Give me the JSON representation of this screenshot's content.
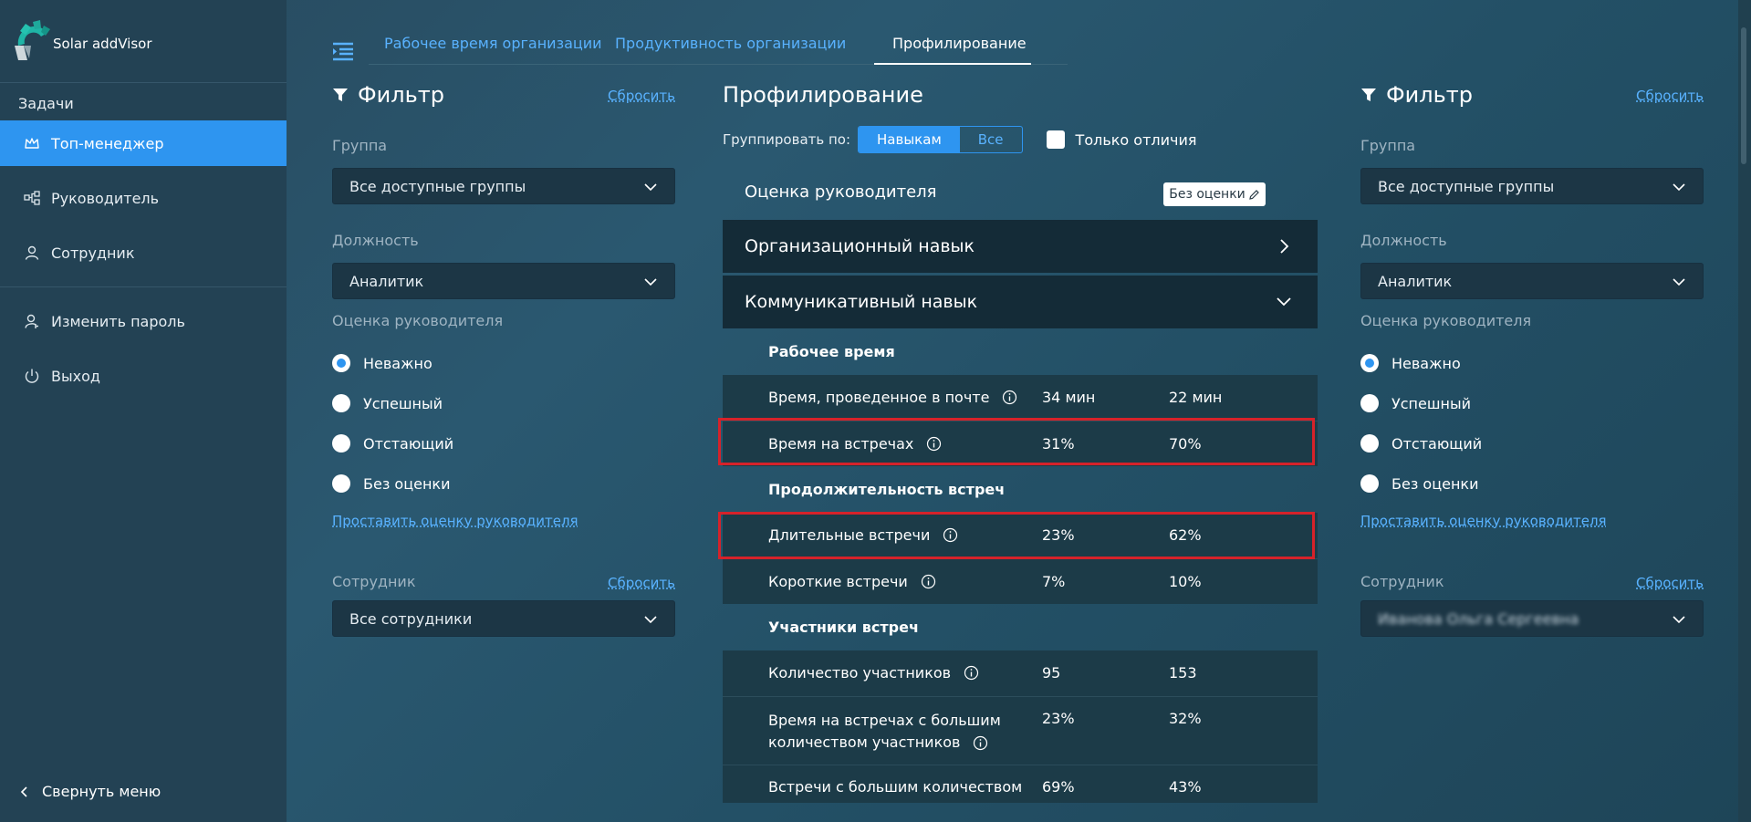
{
  "app": {
    "logo_text": "Solar addVisor"
  },
  "sidebar": {
    "heading": "Задачи",
    "items": [
      {
        "label": "Топ-менеджер",
        "icon": "crown-icon",
        "active": true
      },
      {
        "label": "Руководитель",
        "icon": "hierarchy-icon",
        "active": false
      },
      {
        "label": "Сотрудник",
        "icon": "user-icon",
        "active": false
      },
      {
        "label": "Изменить пароль",
        "icon": "user-key-icon",
        "active": false
      },
      {
        "label": "Выход",
        "icon": "power-icon",
        "active": false
      }
    ],
    "collapse_label": "Свернуть меню"
  },
  "tabs": [
    {
      "label": "Рабочее время организации",
      "active": false
    },
    {
      "label": "Продуктивность организации",
      "active": false
    },
    {
      "label": "Профилирование",
      "active": true
    }
  ],
  "filter_left": {
    "title": "Фильтр",
    "reset": "Сбросить",
    "group_label": "Группа",
    "group_value": "Все доступные группы",
    "position_label": "Должность",
    "position_value": "Аналитик",
    "eval_label": "Оценка руководителя",
    "radios": [
      "Неважно",
      "Успешный",
      "Отстающий",
      "Без оценки"
    ],
    "selected_radio": "Неважно",
    "set_eval_link": "Проставить оценку руководителя",
    "employee_label": "Сотрудник",
    "employee_reset": "Сбросить",
    "employee_value": "Все сотрудники"
  },
  "filter_right": {
    "title": "Фильтр",
    "reset": "Сбросить",
    "group_label": "Группа",
    "group_value": "Все доступные группы",
    "position_label": "Должность",
    "position_value": "Аналитик",
    "eval_label": "Оценка руководителя",
    "radios": [
      "Неважно",
      "Успешный",
      "Отстающий",
      "Без оценки"
    ],
    "selected_radio": "Неважно",
    "set_eval_link": "Проставить оценку руководителя",
    "employee_label": "Сотрудник",
    "employee_reset": "Сбросить",
    "employee_value": "Иванова Ольга Сергеевна"
  },
  "center": {
    "title": "Профилирование",
    "group_by_label": "Группировать по:",
    "group_by_options": [
      "Навыкам",
      "Все"
    ],
    "group_by_selected": "Навыкам",
    "only_diff_label": "Только отличия",
    "eval_title": "Оценка руководителя",
    "no_eval_button": "Без оценки",
    "accordions": [
      {
        "label": "Организационный навык",
        "expanded": false
      },
      {
        "label": "Коммуникативный навык",
        "expanded": true
      }
    ],
    "sections": [
      {
        "title": "Рабочее время",
        "rows": [
          {
            "name": "Время, проведенное в почте",
            "v1": "34 мин",
            "v2": "22 мин",
            "info": true
          },
          {
            "name": "Время на встречах",
            "v1": "31%",
            "v2": "70%",
            "info": true,
            "highlighted": true
          }
        ]
      },
      {
        "title": "Продолжительность встреч",
        "rows": [
          {
            "name": "Длительные встречи",
            "v1": "23%",
            "v2": "62%",
            "info": true,
            "highlighted": true
          },
          {
            "name": "Короткие встречи",
            "v1": "7%",
            "v2": "10%",
            "info": true
          }
        ]
      },
      {
        "title": "Участники встреч",
        "rows": [
          {
            "name": "Количество участников",
            "v1": "95",
            "v2": "153",
            "info": true
          },
          {
            "name": "Время на встречах с большим",
            "name2": "количеством участников",
            "v1": "23%",
            "v2": "32%",
            "info": true
          },
          {
            "name": "Встречи с большим количеством",
            "v1": "69%",
            "v2": "43%",
            "info": false
          }
        ]
      }
    ]
  },
  "colors": {
    "accent": "#2e95f0",
    "link": "#59b2ff",
    "highlight": "#d6222a",
    "sidebar": "#234254"
  }
}
